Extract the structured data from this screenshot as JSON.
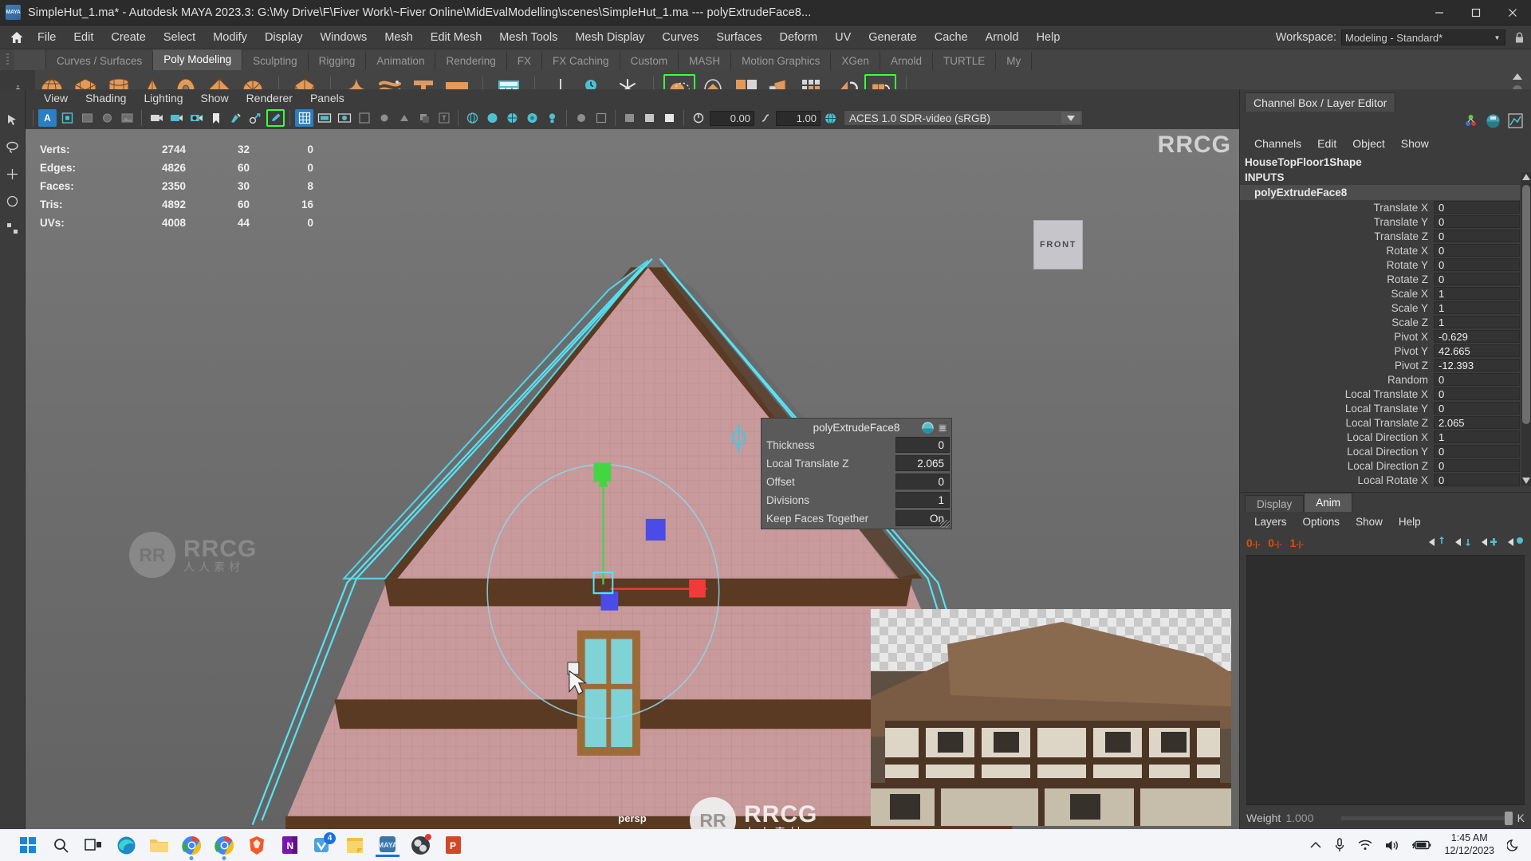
{
  "titlebar": {
    "title": "SimpleHut_1.ma* - Autodesk MAYA 2023.3: G:\\My Drive\\F\\Fiver Work\\~Fiver Online\\MidEvalModelling\\scenes\\SimpleHut_1.ma  ---  polyExtrudeFace8...",
    "app_badge": "MAYA",
    "minimize": "—",
    "maximize": "▣",
    "close": "✕"
  },
  "menubar": {
    "items": [
      "File",
      "Edit",
      "Create",
      "Select",
      "Modify",
      "Display",
      "Windows",
      "Mesh",
      "Edit Mesh",
      "Mesh Tools",
      "Mesh Display",
      "Curves",
      "Surfaces",
      "Deform",
      "UV",
      "Generate",
      "Cache",
      "Arnold",
      "Help"
    ],
    "workspace_label": "Workspace:",
    "workspace_value": "Modeling - Standard*"
  },
  "shelf": {
    "tabs": [
      "Curves / Surfaces",
      "Poly Modeling",
      "Sculpting",
      "Rigging",
      "Animation",
      "Rendering",
      "FX",
      "FX Caching",
      "Custom",
      "MASH",
      "Motion Graphics",
      "XGen",
      "Arnold",
      "TURTLE",
      "My"
    ],
    "active_tab": "Poly Modeling",
    "icons": [
      {
        "name": "poly-sphere-icon",
        "glyph": "sphere"
      },
      {
        "name": "poly-cube-icon",
        "glyph": "cube"
      },
      {
        "name": "poly-cylinder-icon",
        "glyph": "cylinder"
      },
      {
        "name": "poly-cone-icon",
        "glyph": "cone"
      },
      {
        "name": "poly-torus-icon",
        "glyph": "torus"
      },
      {
        "name": "poly-plane-icon",
        "glyph": "diamond"
      },
      {
        "name": "poly-disc-icon",
        "glyph": "disc"
      },
      {
        "name": "poly-prism-icon",
        "glyph": "prism"
      },
      {
        "name": "sculpt-icon",
        "glyph": "star"
      },
      {
        "name": "helix-icon",
        "glyph": "helix"
      },
      {
        "name": "type-icon",
        "glyph": "T"
      },
      {
        "name": "svg-icon",
        "glyph": "svg"
      },
      {
        "name": "grid-tool-icon",
        "glyph": "grid"
      },
      {
        "name": "snap-align-icon",
        "glyph": "snap"
      },
      {
        "name": "time-icon",
        "glyph": "clock"
      },
      {
        "name": "freeze-icon",
        "glyph": "snowflake"
      },
      {
        "name": "combine-icon",
        "glyph": "combine"
      },
      {
        "name": "smooth-icon",
        "glyph": "smooth"
      },
      {
        "name": "extrude-icon",
        "glyph": "extrude"
      },
      {
        "name": "bevel-icon",
        "glyph": "bevel"
      },
      {
        "name": "bridge-icon",
        "glyph": "bridge"
      },
      {
        "name": "merge-icon",
        "glyph": "merge"
      },
      {
        "name": "mirror-icon",
        "glyph": "mirror"
      }
    ]
  },
  "viewport": {
    "menus": [
      "View",
      "Shading",
      "Lighting",
      "Show",
      "Renderer",
      "Panels"
    ],
    "toolbar": {
      "select_toggle": "A",
      "num_left": "0.00",
      "num_right": "1.00",
      "colorspace": "ACES 1.0 SDR-video (sRGB)"
    },
    "hud": {
      "rows": [
        {
          "label": "Verts:",
          "total": "2744",
          "selected": "32",
          "extra": "0"
        },
        {
          "label": "Edges:",
          "total": "4826",
          "selected": "60",
          "extra": "0"
        },
        {
          "label": "Faces:",
          "total": "2350",
          "selected": "30",
          "extra": "8"
        },
        {
          "label": "Tris:",
          "total": "4892",
          "selected": "60",
          "extra": "16"
        },
        {
          "label": "UVs:",
          "total": "4008",
          "selected": "44",
          "extra": "0"
        }
      ]
    },
    "axis_label": "FRONT",
    "camera_label": "persp",
    "tool_settings": {
      "title": "polyExtrudeFace8",
      "rows": [
        {
          "key": "Thickness",
          "value": "0"
        },
        {
          "key": "Local Translate Z",
          "value": "2.065"
        },
        {
          "key": "Offset",
          "value": "0"
        },
        {
          "key": "Divisions",
          "value": "1"
        },
        {
          "key": "Keep Faces Together",
          "value": "On"
        }
      ]
    }
  },
  "channelbox": {
    "panel_tab": "Channel Box / Layer Editor",
    "menus": [
      "Channels",
      "Edit",
      "Object",
      "Show"
    ],
    "node_name": "HouseTopFloor1Shape",
    "inputs_label": "INPUTS",
    "input_node": "polyExtrudeFace8",
    "attributes": [
      {
        "key": "Translate X",
        "value": "0"
      },
      {
        "key": "Translate Y",
        "value": "0"
      },
      {
        "key": "Translate Z",
        "value": "0"
      },
      {
        "key": "Rotate X",
        "value": "0"
      },
      {
        "key": "Rotate Y",
        "value": "0"
      },
      {
        "key": "Rotate Z",
        "value": "0"
      },
      {
        "key": "Scale X",
        "value": "1"
      },
      {
        "key": "Scale Y",
        "value": "1"
      },
      {
        "key": "Scale Z",
        "value": "1"
      },
      {
        "key": "Pivot X",
        "value": "-0.629"
      },
      {
        "key": "Pivot Y",
        "value": "42.665"
      },
      {
        "key": "Pivot Z",
        "value": "-12.393"
      },
      {
        "key": "Random",
        "value": "0"
      },
      {
        "key": "Local Translate X",
        "value": "0"
      },
      {
        "key": "Local Translate Y",
        "value": "0"
      },
      {
        "key": "Local Translate Z",
        "value": "2.065"
      },
      {
        "key": "Local Direction X",
        "value": "1"
      },
      {
        "key": "Local Direction Y",
        "value": "0"
      },
      {
        "key": "Local Direction Z",
        "value": "0"
      },
      {
        "key": "Local Rotate X",
        "value": "0"
      }
    ]
  },
  "layereditor": {
    "tabs": [
      "Display",
      "Anim"
    ],
    "active_tab": "Anim",
    "menus": [
      "Layers",
      "Options",
      "Show",
      "Help"
    ],
    "keyframe_buttons": [
      "0",
      "0",
      "1"
    ],
    "weight_label": "Weight",
    "weight_value": "1.000",
    "key_button": "K"
  },
  "taskbar": {
    "items": [
      {
        "name": "start-button",
        "label": "Start"
      },
      {
        "name": "search-button",
        "label": "Search"
      },
      {
        "name": "task-view-button",
        "label": "Task View"
      },
      {
        "name": "edge-button",
        "label": "Microsoft Edge"
      },
      {
        "name": "file-explorer-button",
        "label": "File Explorer"
      },
      {
        "name": "chrome-button",
        "label": "Google Chrome"
      },
      {
        "name": "chrome2-button",
        "label": "Google Chrome"
      },
      {
        "name": "brave-button",
        "label": "Brave"
      },
      {
        "name": "onenote-button",
        "label": "OneNote",
        "badge": ""
      },
      {
        "name": "teams-button",
        "label": "Teams",
        "badge": "4"
      },
      {
        "name": "notepad-button",
        "label": "Sticky Notes"
      },
      {
        "name": "maya-button",
        "label": "Autodesk Maya"
      },
      {
        "name": "obs-button",
        "label": "OBS Studio"
      },
      {
        "name": "powerpoint-button",
        "label": "PowerPoint"
      }
    ],
    "tray": {
      "time": "1:45 AM",
      "date": "12/12/2023"
    }
  },
  "watermark": {
    "brand": "RRCG",
    "sub": "人人素材",
    "logo": "RR"
  }
}
